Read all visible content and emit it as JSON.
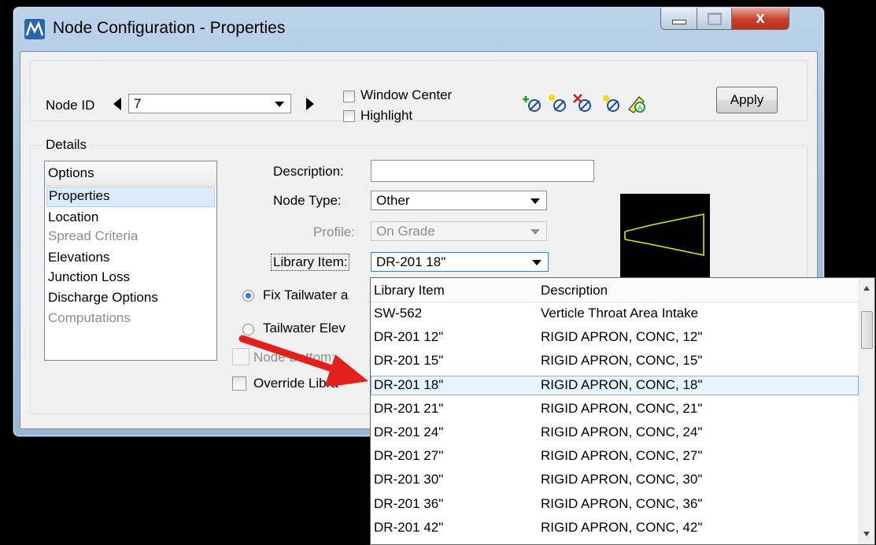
{
  "window": {
    "title": "Node Configuration - Properties",
    "close_glyph": "x"
  },
  "toolbar": {
    "node_id_label": "Node ID",
    "node_id_value": "7",
    "window_center_label": "Window Center",
    "highlight_label": "Highlight",
    "apply_label": "Apply",
    "icons": [
      "add-node-icon",
      "insert-node-icon",
      "delete-node-icon",
      "renumber-node-icon",
      "annotate-icon"
    ]
  },
  "details": {
    "group_label": "Details",
    "options_header": "Options",
    "options": [
      {
        "label": "Properties",
        "state": "selected"
      },
      {
        "label": "Location",
        "state": "enabled"
      },
      {
        "label": "Spread Criteria",
        "state": "disabled"
      },
      {
        "label": "Elevations",
        "state": "enabled"
      },
      {
        "label": "Junction Loss",
        "state": "enabled"
      },
      {
        "label": "Discharge Options",
        "state": "enabled"
      },
      {
        "label": "Computations",
        "state": "disabled"
      }
    ],
    "description_label": "Description:",
    "description_value": "",
    "node_type_label": "Node Type:",
    "node_type_value": "Other",
    "profile_label": "Profile:",
    "profile_value": "On Grade",
    "library_item_label": "Library Item:",
    "library_item_value": "DR-201 18\"",
    "fix_tailwater_label": "Fix Tailwater a",
    "tailwater_elev_label": "Tailwater Elev",
    "node_bottom_label": "Node Bottom:",
    "override_label": "Override Libra"
  },
  "dropdown": {
    "col1_header": "Library Item",
    "col2_header": "Description",
    "rows": [
      {
        "item": "SW-562",
        "desc": "Verticle Throat Area Intake"
      },
      {
        "item": "DR-201 12\"",
        "desc": "RIGID APRON, CONC, 12\""
      },
      {
        "item": "DR-201 15\"",
        "desc": "RIGID APRON, CONC, 15\""
      },
      {
        "item": "DR-201 18\"",
        "desc": "RIGID APRON, CONC, 18\"",
        "selected": true
      },
      {
        "item": "DR-201 21\"",
        "desc": "RIGID APRON, CONC, 21\""
      },
      {
        "item": "DR-201 24\"",
        "desc": "RIGID APRON, CONC, 24\""
      },
      {
        "item": "DR-201 27\"",
        "desc": "RIGID APRON, CONC, 27\""
      },
      {
        "item": "DR-201 30\"",
        "desc": "RIGID APRON, CONC, 30\""
      },
      {
        "item": "DR-201 36\"",
        "desc": "RIGID APRON, CONC, 36\""
      },
      {
        "item": "DR-201 42\"",
        "desc": "RIGID APRON, CONC, 42\""
      }
    ]
  },
  "colors": {
    "arrow": "#e3201b",
    "preview_outline": "#e8e000",
    "selection": "#e5f3fb"
  }
}
